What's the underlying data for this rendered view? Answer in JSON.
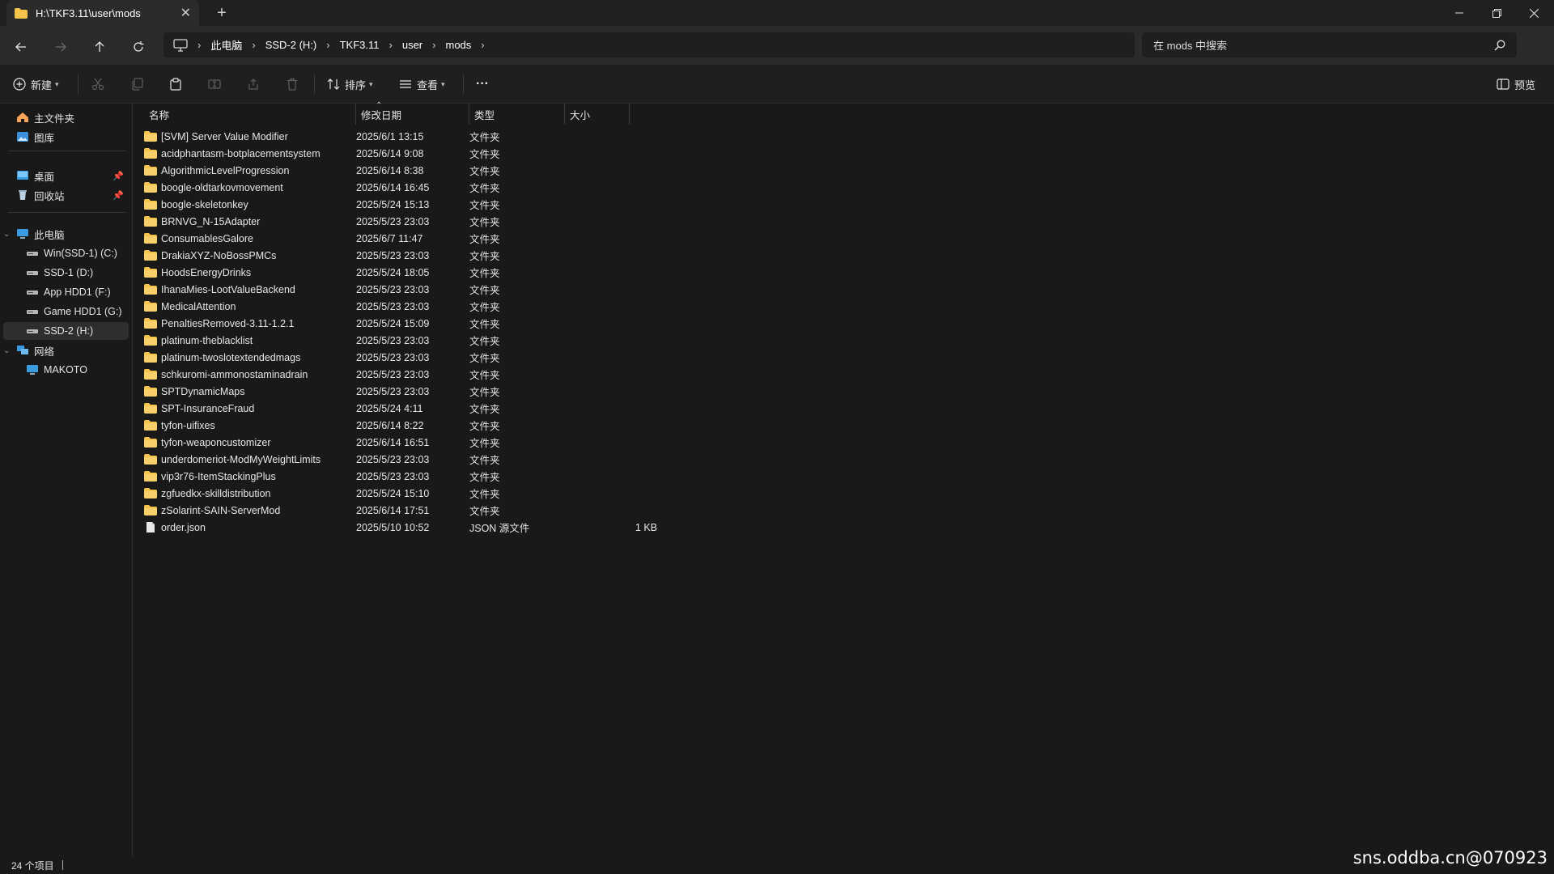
{
  "window": {
    "tab_title": "H:\\TKF3.11\\user\\mods",
    "new_tab": "+",
    "close_tab": "✕"
  },
  "nav": {
    "breadcrumb": [
      "此电脑",
      "SSD-2 (H:)",
      "TKF3.11",
      "user",
      "mods"
    ],
    "search_placeholder": "在 mods 中搜索"
  },
  "commands": {
    "new": "新建",
    "sort": "排序",
    "view": "查看",
    "more": "···",
    "preview": "预览"
  },
  "sidebar": {
    "quick": [
      {
        "label": "主文件夹",
        "icon": "home-icon"
      },
      {
        "label": "图库",
        "icon": "gallery-icon"
      }
    ],
    "pinned": [
      {
        "label": "桌面",
        "icon": "desktop-icon"
      },
      {
        "label": "回收站",
        "icon": "recycle-bin-icon"
      }
    ],
    "this_pc": "此电脑",
    "drives": [
      {
        "label": "Win(SSD-1) (C:)"
      },
      {
        "label": "SSD-1 (D:)"
      },
      {
        "label": "App HDD1 (F:)"
      },
      {
        "label": "Game HDD1 (G:)"
      },
      {
        "label": "SSD-2 (H:)"
      }
    ],
    "network": "网络",
    "network_items": [
      "MAKOTO"
    ]
  },
  "columns": {
    "name": "名称",
    "date": "修改日期",
    "type": "类型",
    "size": "大小"
  },
  "files": [
    {
      "name": "[SVM] Server Value Modifier",
      "date": "2025/6/1 13:15",
      "type": "文件夹",
      "size": "",
      "kind": "folder"
    },
    {
      "name": "acidphantasm-botplacementsystem",
      "date": "2025/6/14 9:08",
      "type": "文件夹",
      "size": "",
      "kind": "folder"
    },
    {
      "name": "AlgorithmicLevelProgression",
      "date": "2025/6/14 8:38",
      "type": "文件夹",
      "size": "",
      "kind": "folder"
    },
    {
      "name": "boogle-oldtarkovmovement",
      "date": "2025/6/14 16:45",
      "type": "文件夹",
      "size": "",
      "kind": "folder"
    },
    {
      "name": "boogle-skeletonkey",
      "date": "2025/5/24 15:13",
      "type": "文件夹",
      "size": "",
      "kind": "folder"
    },
    {
      "name": "BRNVG_N-15Adapter",
      "date": "2025/5/23 23:03",
      "type": "文件夹",
      "size": "",
      "kind": "folder"
    },
    {
      "name": "ConsumablesGalore",
      "date": "2025/6/7 11:47",
      "type": "文件夹",
      "size": "",
      "kind": "folder"
    },
    {
      "name": "DrakiaXYZ-NoBossPMCs",
      "date": "2025/5/23 23:03",
      "type": "文件夹",
      "size": "",
      "kind": "folder"
    },
    {
      "name": "HoodsEnergyDrinks",
      "date": "2025/5/24 18:05",
      "type": "文件夹",
      "size": "",
      "kind": "folder"
    },
    {
      "name": "IhanaMies-LootValueBackend",
      "date": "2025/5/23 23:03",
      "type": "文件夹",
      "size": "",
      "kind": "folder"
    },
    {
      "name": "MedicalAttention",
      "date": "2025/5/23 23:03",
      "type": "文件夹",
      "size": "",
      "kind": "folder"
    },
    {
      "name": "PenaltiesRemoved-3.11-1.2.1",
      "date": "2025/5/24 15:09",
      "type": "文件夹",
      "size": "",
      "kind": "folder"
    },
    {
      "name": "platinum-theblacklist",
      "date": "2025/5/23 23:03",
      "type": "文件夹",
      "size": "",
      "kind": "folder"
    },
    {
      "name": "platinum-twoslotextendedmags",
      "date": "2025/5/23 23:03",
      "type": "文件夹",
      "size": "",
      "kind": "folder"
    },
    {
      "name": "schkuromi-ammonostaminadrain",
      "date": "2025/5/23 23:03",
      "type": "文件夹",
      "size": "",
      "kind": "folder"
    },
    {
      "name": "SPTDynamicMaps",
      "date": "2025/5/23 23:03",
      "type": "文件夹",
      "size": "",
      "kind": "folder"
    },
    {
      "name": "SPT-InsuranceFraud",
      "date": "2025/5/24 4:11",
      "type": "文件夹",
      "size": "",
      "kind": "folder"
    },
    {
      "name": "tyfon-uifixes",
      "date": "2025/6/14 8:22",
      "type": "文件夹",
      "size": "",
      "kind": "folder"
    },
    {
      "name": "tyfon-weaponcustomizer",
      "date": "2025/6/14 16:51",
      "type": "文件夹",
      "size": "",
      "kind": "folder"
    },
    {
      "name": "underdomeriot-ModMyWeightLimits",
      "date": "2025/5/23 23:03",
      "type": "文件夹",
      "size": "",
      "kind": "folder"
    },
    {
      "name": "vip3r76-ItemStackingPlus",
      "date": "2025/5/23 23:03",
      "type": "文件夹",
      "size": "",
      "kind": "folder"
    },
    {
      "name": "zgfuedkx-skilldistribution",
      "date": "2025/5/24 15:10",
      "type": "文件夹",
      "size": "",
      "kind": "folder"
    },
    {
      "name": "zSolarint-SAIN-ServerMod",
      "date": "2025/6/14 17:51",
      "type": "文件夹",
      "size": "",
      "kind": "folder"
    },
    {
      "name": "order.json",
      "date": "2025/5/10 10:52",
      "type": "JSON 源文件",
      "size": "1 KB",
      "kind": "file"
    }
  ],
  "status": {
    "count": "24 个项目"
  },
  "watermark": "sns.oddba.cn@070923",
  "colors": {
    "folder": "#f5c44b",
    "background": "#191919",
    "chrome": "#2b2b2b",
    "accent": "#4cc2ff"
  }
}
